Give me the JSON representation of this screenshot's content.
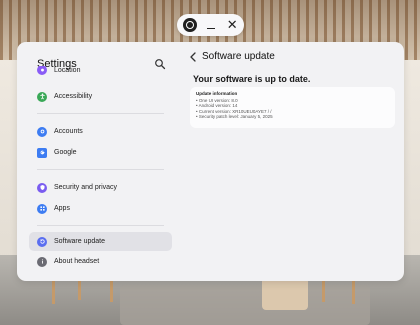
{
  "window_controls": {
    "apps_icon": "apps-circle-icon",
    "minimize_icon": "minimize-icon",
    "close_icon": "close-icon",
    "close_glyph": "✕"
  },
  "sidebar": {
    "title": "Settings",
    "search_icon": "search-icon",
    "items": [
      {
        "label": "Location",
        "icon": "location-icon",
        "color": "#8a5cf6"
      },
      {
        "label": "Accessibility",
        "icon": "accessibility-icon",
        "color": "#3aa857"
      },
      {
        "label": "Accounts",
        "icon": "key-icon",
        "color": "#3d7cf2"
      },
      {
        "label": "Google",
        "icon": "google-icon",
        "color": "#3d7cf2"
      },
      {
        "label": "Security and privacy",
        "icon": "shield-icon",
        "color": "#7a5cf0"
      },
      {
        "label": "Apps",
        "icon": "apps-icon",
        "color": "#3d7cf2"
      },
      {
        "label": "Software update",
        "icon": "update-icon",
        "color": "#5a6ef0",
        "active": true
      },
      {
        "label": "About headset",
        "icon": "info-icon",
        "color": "#6b6b73"
      }
    ]
  },
  "content": {
    "title": "Software update",
    "status": "Your software is up to date.",
    "info": {
      "heading": "Update information",
      "lines": [
        "• One UI version: 8.0",
        "• Android version: 14",
        "• Current version: XR10UEU0AYE7 /  /",
        "• Security patch level: January 5, 2025"
      ]
    }
  },
  "colors": {
    "window_bg": "#f2f2f4",
    "active_item_bg": "#e1e1e6",
    "card_bg": "#fcfcfd"
  }
}
